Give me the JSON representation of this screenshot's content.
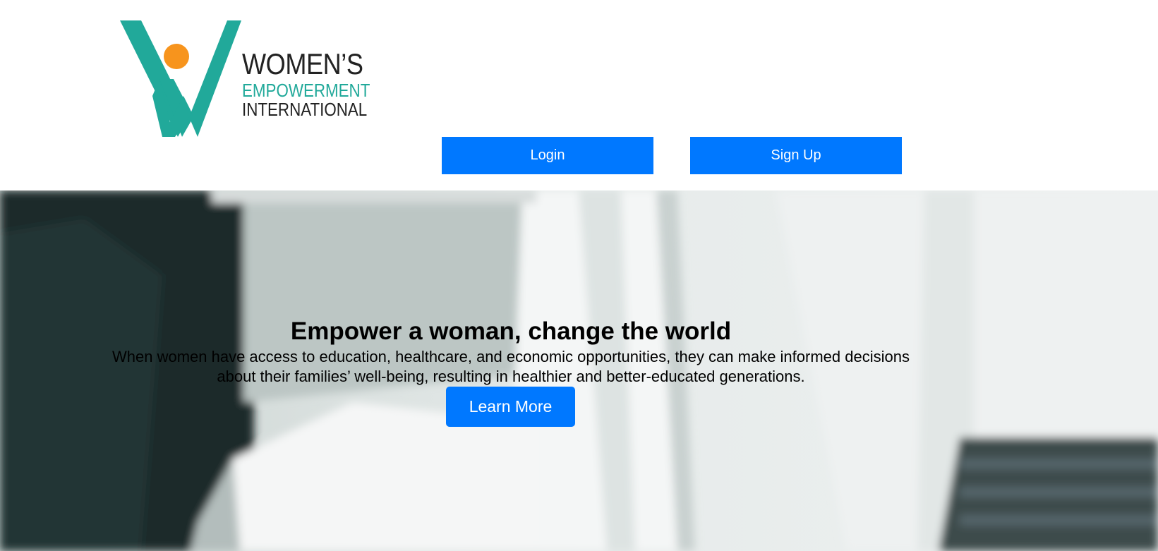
{
  "header": {
    "logo": {
      "line1": "WOMEN’S",
      "line2": "EMPOWERMENT",
      "line3": "INTERNATIONAL",
      "colors": {
        "teal": "#21a99a",
        "orange": "#f7941d",
        "dark": "#222222"
      }
    },
    "login_label": "Login",
    "signup_label": "Sign Up"
  },
  "hero": {
    "title": "Empower a woman, change the world",
    "text": "When women have access to education, healthcare, and economic opportunities, they can make informed decisions about their families’ well-being, resulting in healthier and better-educated generations.",
    "learn_more_label": "Learn More"
  },
  "colors": {
    "accent": "#0078ff",
    "text": "#000000"
  }
}
